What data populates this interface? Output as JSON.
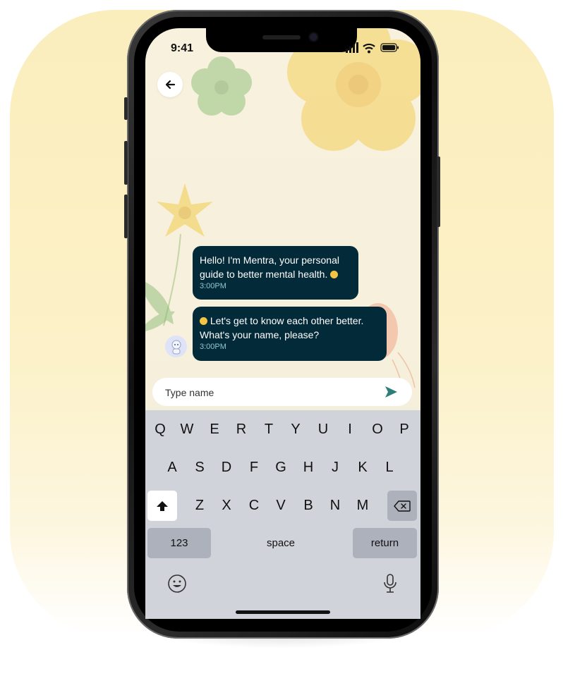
{
  "status_bar": {
    "time": "9:41"
  },
  "chat": {
    "messages": [
      {
        "text": "Hello! I'm Mentra, your personal\nguide to better mental health. ",
        "time": "3:00PM"
      },
      {
        "text": " Let's get to know each other better.\nWhat's your name, please?",
        "time": "3:00PM"
      }
    ]
  },
  "input": {
    "placeholder": "Type name",
    "value": ""
  },
  "keyboard": {
    "row1": [
      "Q",
      "W",
      "E",
      "R",
      "T",
      "Y",
      "U",
      "I",
      "O",
      "P"
    ],
    "row2": [
      "A",
      "S",
      "D",
      "F",
      "G",
      "H",
      "J",
      "K",
      "L"
    ],
    "row3": [
      "Z",
      "X",
      "C",
      "V",
      "B",
      "N",
      "M"
    ],
    "numbers_label": "123",
    "space_label": "space",
    "return_label": "return"
  },
  "icons": {
    "back": "arrow-left-icon",
    "send": "send-icon",
    "shift": "shift-icon",
    "delete": "backspace-icon",
    "emoji": "emoji-icon",
    "mic": "microphone-icon"
  },
  "colors": {
    "bubble": "#032a38",
    "bubble_time": "#8fc7d1",
    "send": "#2e7d78",
    "backdrop": "#fbeebd"
  }
}
